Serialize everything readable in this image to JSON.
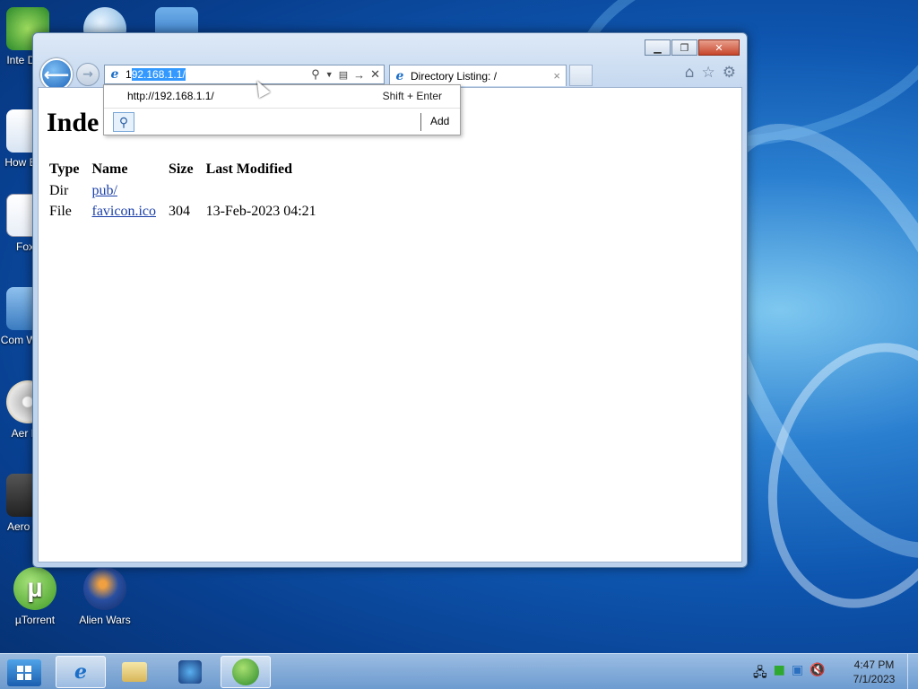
{
  "desktop": {
    "icons": [
      {
        "label": "Inte Dow",
        "color": "#2b8a2b"
      },
      {
        "label": "How Blue",
        "color": "#d8e4f3"
      },
      {
        "label": "Foxit",
        "color": "#e8eef7"
      },
      {
        "label": "Com Worm",
        "color": "#3a7bc0"
      },
      {
        "label": "Aer Bu",
        "color": "#c4a040"
      },
      {
        "label": "Aero Pla",
        "color": "#222222"
      },
      {
        "label": "µTorrent",
        "color": "#5fb83b"
      },
      {
        "label": "Alien Wars",
        "color": "#2a4fa0"
      }
    ]
  },
  "browser": {
    "window_buttons": {
      "minimize": "▁",
      "maximize": "❐",
      "close": "✕"
    },
    "address": {
      "typed_prefix": "1",
      "selected_completion": "92.168.1.1/"
    },
    "tab": {
      "title": "Directory Listing: /",
      "close": "×"
    },
    "toolbar_icons": [
      "home-icon",
      "favorites-icon",
      "tools-icon"
    ],
    "autocomplete": {
      "url": "http://192.168.1.1/",
      "hint": "Shift + Enter",
      "add_label": "Add"
    }
  },
  "page": {
    "heading": "Inde",
    "columns": [
      "Type",
      "Name",
      "Size",
      "Last Modified"
    ],
    "rows": [
      {
        "type": "Dir",
        "name": "pub/",
        "size": "",
        "modified": ""
      },
      {
        "type": "File",
        "name": "favicon.ico",
        "size": "304",
        "modified": "13-Feb-2023 04:21"
      }
    ]
  },
  "taskbar": {
    "items": [
      "internet-explorer-icon",
      "file-explorer-icon",
      "media-player-icon",
      "download-manager-icon"
    ],
    "clock": {
      "time": "4:47 PM",
      "date": "7/1/2023"
    }
  }
}
